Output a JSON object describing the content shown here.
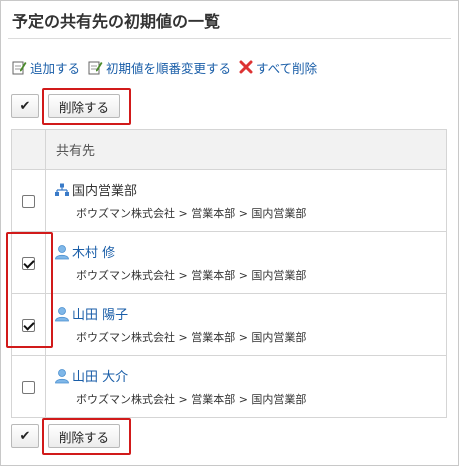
{
  "page": {
    "title": "予定の共有先の初期値の一覧"
  },
  "toolbar": {
    "add_label": "追加する",
    "reorder_label": "初期値を順番変更する",
    "delete_all_label": "すべて削除"
  },
  "actions": {
    "check_all_glyph": "✔",
    "delete_label": "削除する"
  },
  "table": {
    "column_header": "共有先",
    "rows": [
      {
        "type": "organization",
        "icon": "org-chart-icon",
        "name": "国内営業部",
        "path": "ボウズマン株式会社 > 営業本部 > 国内営業部",
        "checked": false
      },
      {
        "type": "user",
        "icon": "user-icon",
        "name": "木村 修",
        "path": "ボウズマン株式会社 > 営業本部 > 国内営業部",
        "checked": true
      },
      {
        "type": "user",
        "icon": "user-icon",
        "name": "山田 陽子",
        "path": "ボウズマン株式会社 > 営業本部 > 国内営業部",
        "checked": true
      },
      {
        "type": "user",
        "icon": "user-icon",
        "name": "山田 大介",
        "path": "ボウズマン株式会社 > 営業本部 > 国内営業部",
        "checked": false
      }
    ]
  },
  "colors": {
    "link": "#1a5ea8",
    "highlight": "#d11a1a",
    "header_bg": "#f2f2f2"
  }
}
